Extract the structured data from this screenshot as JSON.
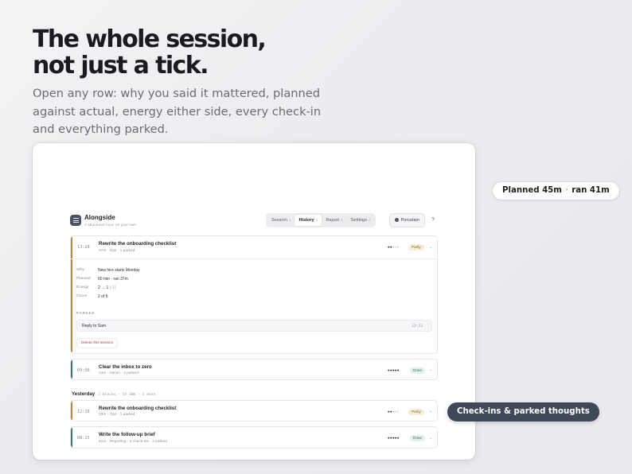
{
  "hero": {
    "headline_line1": "The whole session,",
    "headline_line2": "not just a tick.",
    "subhead": "Open any row: why you said it mattered, planned against actual, energy either side, every check-in and everything parked."
  },
  "app": {
    "name": "Alongside",
    "tagline": "A structured hour, on your own",
    "tabs": [
      {
        "label": "Session",
        "key": "1",
        "active": false
      },
      {
        "label": "History",
        "key": "2",
        "active": true
      },
      {
        "label": "Report",
        "key": "3",
        "active": false
      },
      {
        "label": "Settings",
        "key": "4",
        "active": false
      }
    ],
    "theme_label": "Porcelain",
    "help_label": "?"
  },
  "sessions": {
    "expanded": {
      "time": "13:28",
      "title": "Rewrite the onboarding checklist",
      "meta": "37m · Ops · 1 parked",
      "rating": 2,
      "status": "Partly",
      "accent_color": "#b88a3e",
      "details": {
        "why_label": "Why",
        "why_value": "New hire starts Monday",
        "planned_label": "Planned",
        "planned_value": "60 min · ran 37m",
        "energy_label": "Energy",
        "energy_value": "2 → 1",
        "energy_delta": "(-1)",
        "focus_label": "Focus",
        "focus_value": "2 of 5"
      },
      "parked_heading": "PARKED",
      "parked_items": [
        {
          "text": "Reply to Sam",
          "time": "13:32"
        }
      ],
      "delete_label": "Delete this session"
    },
    "today_rest": [
      {
        "time": "09:08",
        "title": "Clear the inbox to zero",
        "meta": "14m · Admin · 2 parked",
        "rating": 5,
        "status": "Done",
        "accent_color": "#3f7a65"
      }
    ],
    "yesterday": {
      "heading": "Yesterday",
      "summary": "2 blocks · 1h 30m · 1 done",
      "items": [
        {
          "time": "12:18",
          "title": "Rewrite the onboarding checklist",
          "meta": "33m · Ops · 1 parked",
          "rating": 2,
          "status": "Partly",
          "accent_color": "#b88a3e"
        },
        {
          "time": "08:25",
          "title": "Write the follow-up brief",
          "meta": "51m · Reporting · 4 check-ins · 2 parked",
          "rating": 5,
          "status": "Done",
          "accent_color": "#3f7a65"
        }
      ]
    }
  },
  "callouts": {
    "planned": {
      "left": "Planned 45m",
      "sep": "·",
      "right": "ran 41m"
    },
    "checkins": "Check-ins & parked thoughts"
  },
  "colors": {
    "partly_bg": "#f6ecd8",
    "done_bg": "#e2efea",
    "dark_pill": "#3f4857",
    "logo": "#4a5366"
  },
  "icons": {
    "logo": "list-lines-icon",
    "chevron": "chevron-down-icon",
    "theme": "theme-dot-icon"
  }
}
